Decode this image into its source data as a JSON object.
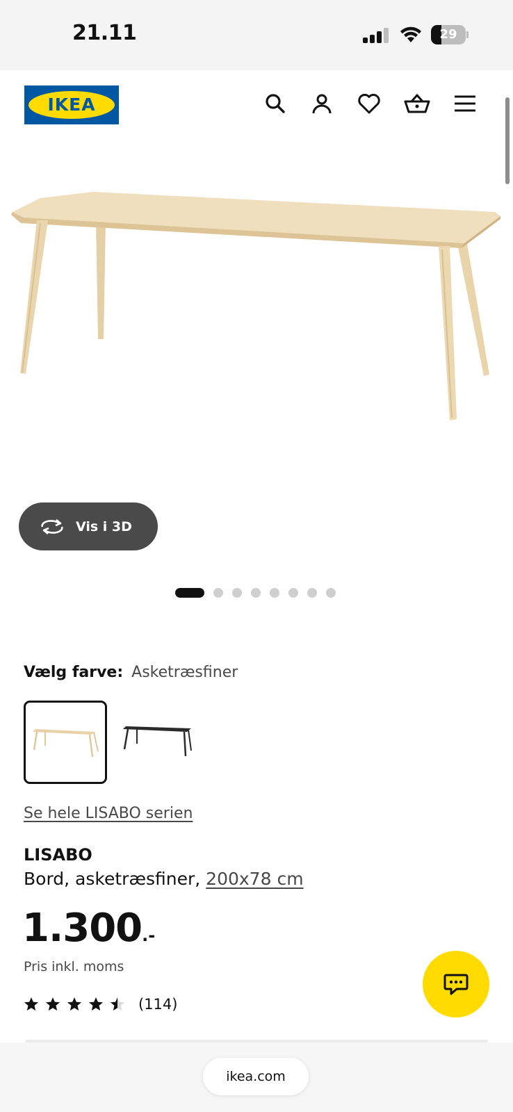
{
  "status_bar": {
    "time": "21.11",
    "battery_level": 29,
    "battery_text": "29"
  },
  "header": {
    "logo_text": "IKEA",
    "icons": [
      "search-icon",
      "user-icon",
      "heart-icon",
      "basket-icon",
      "menu-icon"
    ],
    "brand_blue": "#0058a3",
    "brand_yellow": "#ffdb00"
  },
  "gallery": {
    "view_3d_label": "Vis i 3D",
    "image_count": 8,
    "active_index": 0
  },
  "color_select": {
    "label": "Vælg farve:",
    "selected_value": "Asketræsfiner",
    "swatches": [
      {
        "name": "asketraesfiner",
        "color": "#ecd9b8",
        "selected": true
      },
      {
        "name": "black",
        "color": "#2a2a2a",
        "selected": false
      }
    ]
  },
  "series_link": "Se hele LISABO serien",
  "product": {
    "name": "LISABO",
    "description_prefix": "Bord, asketræsfiner,",
    "size_link": "200x78 cm",
    "price_main": "1.300",
    "price_suffix": ".-",
    "price_note": "Pris inkl. moms",
    "rating_value": 4.5,
    "rating_max": 5,
    "review_count": "(114)"
  },
  "chat": {
    "icon": "chat-icon",
    "color": "#ffdb00"
  },
  "browser": {
    "url": "ikea.com"
  }
}
